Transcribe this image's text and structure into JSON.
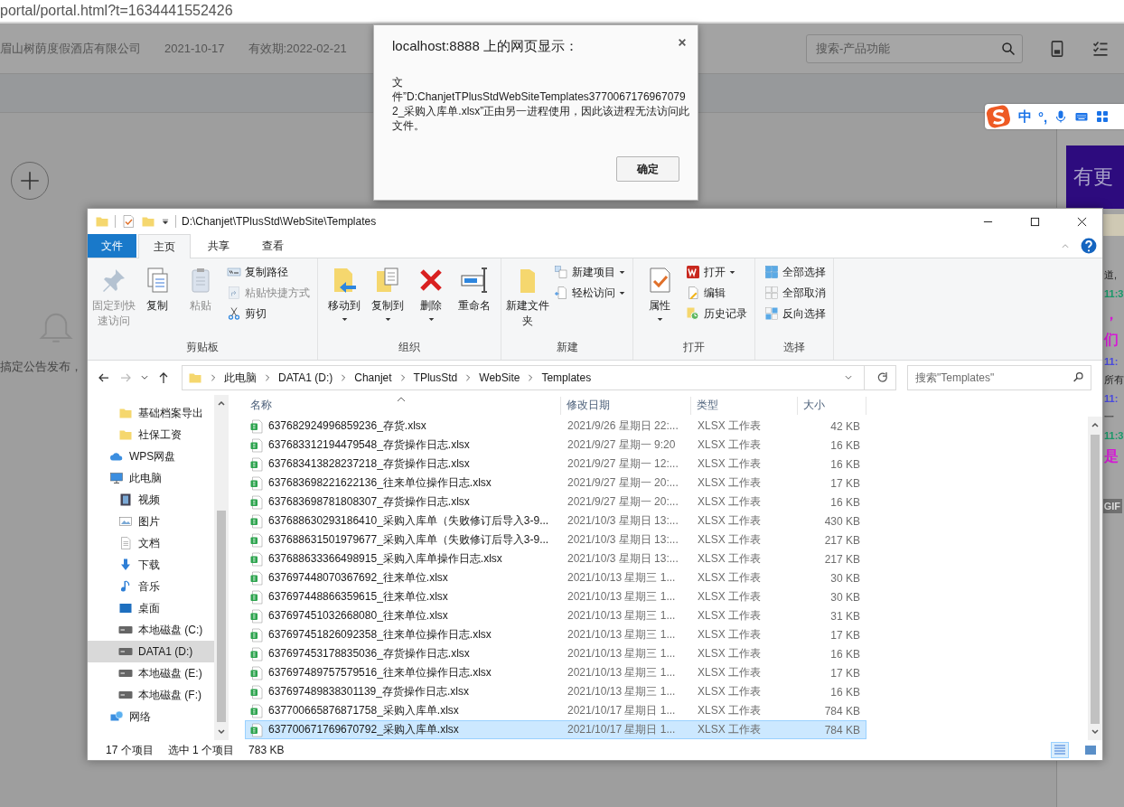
{
  "browser": {
    "url": "portal/portal.html?t=1634441552426",
    "company": "眉山树荫度假酒店有限公司",
    "date": "2021-10-17",
    "validity": "有效期:2022-02-21",
    "search": {
      "placeholder": "搜索-产品功能"
    },
    "notice": "搞定公告发布，",
    "update_banner": "有更",
    "chat": [
      {
        "kind": "text",
        "text": "道,"
      },
      {
        "kind": "time",
        "text": "11:3",
        "color": "#1a9a6a"
      },
      {
        "kind": "highlight",
        "text": "，"
      },
      {
        "kind": "highlight",
        "text": "们"
      },
      {
        "kind": "time",
        "text": "11:",
        "color": "#4a4ae0"
      },
      {
        "kind": "text",
        "text": "所有"
      },
      {
        "kind": "time",
        "text": "11:",
        "color": "#4a4ae0"
      },
      {
        "kind": "text",
        "text": "一"
      },
      {
        "kind": "time",
        "text": "11:3",
        "color": "#1a9a6a"
      },
      {
        "kind": "highlight",
        "text": "是"
      }
    ],
    "gif_button": "GIF"
  },
  "alert": {
    "title": "localhost:8888 上的网页显示：",
    "message": "文件”D:ChanjetTPlusStdWebSiteTemplates37700671769670792_采购入库单.xlsx”正由另一进程使用，因此该进程无法访问此文件。",
    "button": "确定"
  },
  "ime": {
    "mode": "中",
    "punctuation": "°,"
  },
  "explorer": {
    "title": "D:\\Chanjet\\TPlusStd\\WebSite\\Templates",
    "tabs": [
      {
        "label": "文件",
        "kind": "file",
        "selected": false
      },
      {
        "label": "主页",
        "kind": "tab",
        "selected": true
      },
      {
        "label": "共享",
        "kind": "tab",
        "selected": false
      },
      {
        "label": "查看",
        "kind": "tab",
        "selected": false
      }
    ],
    "ribbon": [
      {
        "label": "剪贴板",
        "large": [
          {
            "label": "固定到快速访问",
            "disabled": true,
            "dropdown": false
          },
          {
            "label": "复制",
            "disabled": false,
            "dropdown": false
          },
          {
            "label": "粘贴",
            "disabled": true,
            "dropdown": false
          }
        ],
        "small": [
          {
            "label": "复制路径",
            "disabled": false,
            "dropdown": false
          },
          {
            "label": "粘贴快捷方式",
            "disabled": true,
            "dropdown": false
          },
          {
            "label": "剪切",
            "disabled": false,
            "dropdown": false
          }
        ]
      },
      {
        "label": "组织",
        "large": [
          {
            "label": "移动到",
            "disabled": false,
            "dropdown": true
          },
          {
            "label": "复制到",
            "disabled": false,
            "dropdown": true
          },
          {
            "label": "删除",
            "disabled": false,
            "dropdown": true
          },
          {
            "label": "重命名",
            "disabled": false,
            "dropdown": false
          }
        ]
      },
      {
        "label": "新建",
        "large": [
          {
            "label": "新建文件夹",
            "disabled": false,
            "dropdown": false
          }
        ],
        "small": [
          {
            "label": "新建项目",
            "disabled": false,
            "dropdown": true
          },
          {
            "label": "轻松访问",
            "disabled": false,
            "dropdown": true
          }
        ]
      },
      {
        "label": "打开",
        "large": [
          {
            "label": "属性",
            "disabled": false,
            "dropdown": true
          }
        ],
        "small": [
          {
            "label": "打开",
            "disabled": false,
            "dropdown": true
          },
          {
            "label": "编辑",
            "disabled": false,
            "dropdown": false
          },
          {
            "label": "历史记录",
            "disabled": false,
            "dropdown": false
          }
        ]
      },
      {
        "label": "选择",
        "small": [
          {
            "label": "全部选择",
            "disabled": false,
            "dropdown": false
          },
          {
            "label": "全部取消",
            "disabled": false,
            "dropdown": false
          },
          {
            "label": "反向选择",
            "disabled": false,
            "dropdown": false
          }
        ]
      }
    ],
    "breadcrumbs": [
      "此电脑",
      "DATA1 (D:)",
      "Chanjet",
      "TPlusStd",
      "WebSite",
      "Templates"
    ],
    "search": {
      "placeholder": "搜索\"Templates\""
    },
    "nav": [
      {
        "label": "基础档案导出",
        "kind": "folder",
        "selected": false
      },
      {
        "label": "社保工资",
        "kind": "folder",
        "selected": false
      },
      {
        "label": "WPS网盘",
        "kind": "cloud",
        "selected": false
      },
      {
        "label": "此电脑",
        "kind": "pc",
        "selected": false,
        "children": [
          {
            "label": "视频",
            "kind": "video",
            "selected": false
          },
          {
            "label": "图片",
            "kind": "picture",
            "selected": false
          },
          {
            "label": "文档",
            "kind": "document",
            "selected": false
          },
          {
            "label": "下载",
            "kind": "download",
            "selected": false
          },
          {
            "label": "音乐",
            "kind": "music",
            "selected": false
          },
          {
            "label": "桌面",
            "kind": "desktop",
            "selected": false
          },
          {
            "label": "本地磁盘 (C:)",
            "kind": "system-drive",
            "selected": false
          },
          {
            "label": "DATA1 (D:)",
            "kind": "drive",
            "selected": true
          },
          {
            "label": "本地磁盘 (E:)",
            "kind": "drive",
            "selected": false
          },
          {
            "label": "本地磁盘 (F:)",
            "kind": "drive",
            "selected": false
          }
        ]
      },
      {
        "label": "网络",
        "kind": "network",
        "selected": false
      }
    ],
    "columns": [
      "名称",
      "修改日期",
      "类型",
      "大小"
    ],
    "rows": [
      {
        "name": "637682924996859236_存货.xlsx",
        "date": "2021/9/26 星期日 22:...",
        "type": "XLSX 工作表",
        "size": "42 KB",
        "selected": false
      },
      {
        "name": "637683312194479548_存货操作日志.xlsx",
        "date": "2021/9/27 星期一 9:20",
        "type": "XLSX 工作表",
        "size": "16 KB",
        "selected": false
      },
      {
        "name": "637683413828237218_存货操作日志.xlsx",
        "date": "2021/9/27 星期一 12:...",
        "type": "XLSX 工作表",
        "size": "16 KB",
        "selected": false
      },
      {
        "name": "637683698221622136_往来单位操作日志.xlsx",
        "date": "2021/9/27 星期一 20:...",
        "type": "XLSX 工作表",
        "size": "17 KB",
        "selected": false
      },
      {
        "name": "637683698781808307_存货操作日志.xlsx",
        "date": "2021/9/27 星期一 20:...",
        "type": "XLSX 工作表",
        "size": "16 KB",
        "selected": false
      },
      {
        "name": "637688630293186410_采购入库单（失败修订后导入3-9...",
        "date": "2021/10/3 星期日 13:...",
        "type": "XLSX 工作表",
        "size": "430 KB",
        "selected": false
      },
      {
        "name": "637688631501979677_采购入库单（失败修订后导入3-9...",
        "date": "2021/10/3 星期日 13:...",
        "type": "XLSX 工作表",
        "size": "217 KB",
        "selected": false
      },
      {
        "name": "637688633366498915_采购入库单操作日志.xlsx",
        "date": "2021/10/3 星期日 13:...",
        "type": "XLSX 工作表",
        "size": "217 KB",
        "selected": false
      },
      {
        "name": "637697448070367692_往来单位.xlsx",
        "date": "2021/10/13 星期三 1...",
        "type": "XLSX 工作表",
        "size": "30 KB",
        "selected": false
      },
      {
        "name": "637697448866359615_往来单位.xlsx",
        "date": "2021/10/13 星期三 1...",
        "type": "XLSX 工作表",
        "size": "30 KB",
        "selected": false
      },
      {
        "name": "637697451032668080_往来单位.xlsx",
        "date": "2021/10/13 星期三 1...",
        "type": "XLSX 工作表",
        "size": "31 KB",
        "selected": false
      },
      {
        "name": "637697451826092358_往来单位操作日志.xlsx",
        "date": "2021/10/13 星期三 1...",
        "type": "XLSX 工作表",
        "size": "17 KB",
        "selected": false
      },
      {
        "name": "637697453178835036_存货操作日志.xlsx",
        "date": "2021/10/13 星期三 1...",
        "type": "XLSX 工作表",
        "size": "16 KB",
        "selected": false
      },
      {
        "name": "637697489757579516_往来单位操作日志.xlsx",
        "date": "2021/10/13 星期三 1...",
        "type": "XLSX 工作表",
        "size": "17 KB",
        "selected": false
      },
      {
        "name": "637697489838301139_存货操作日志.xlsx",
        "date": "2021/10/13 星期三 1...",
        "type": "XLSX 工作表",
        "size": "16 KB",
        "selected": false
      },
      {
        "name": "637700665876871758_采购入库单.xlsx",
        "date": "2021/10/17 星期日 1...",
        "type": "XLSX 工作表",
        "size": "784 KB",
        "selected": false
      },
      {
        "name": "637700671769670792_采购入库单.xlsx",
        "date": "2021/10/17 星期日 1...",
        "type": "XLSX 工作表",
        "size": "784 KB",
        "selected": true
      }
    ],
    "status": {
      "count": "17 个项目",
      "selection": "选中 1 个项目",
      "size": "783 KB"
    }
  }
}
